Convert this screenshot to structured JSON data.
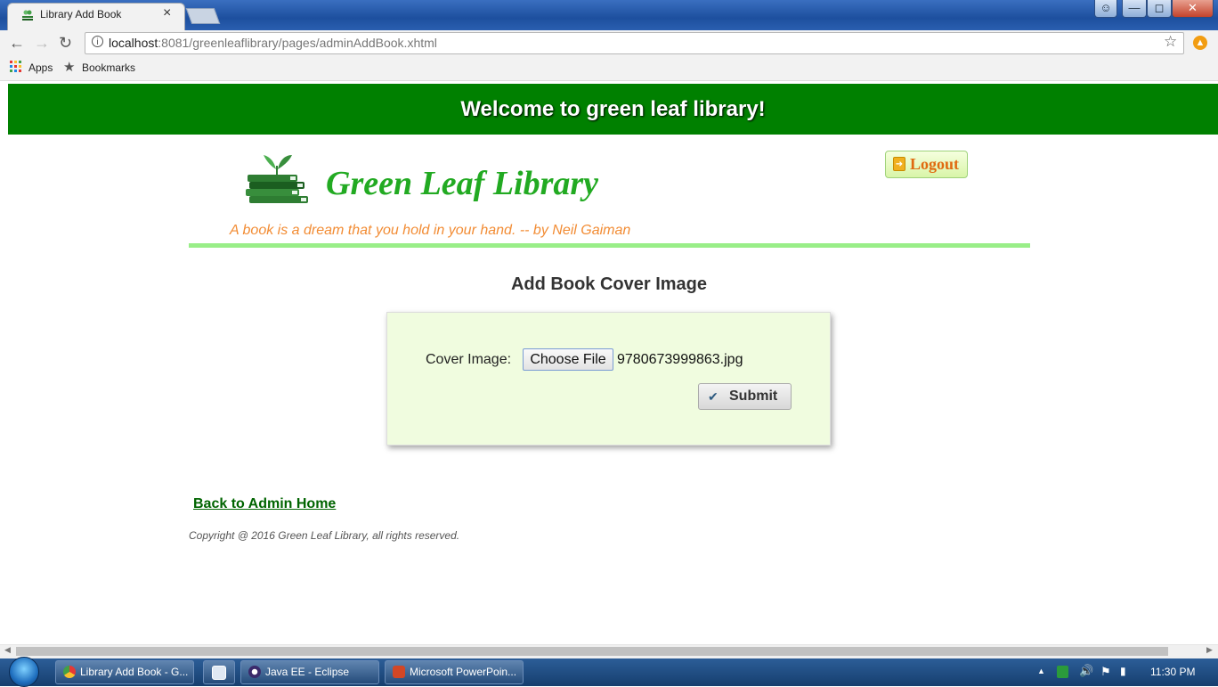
{
  "browser": {
    "tab_title": "Library Add Book",
    "tab_close": "×",
    "url_host": "localhost",
    "url_rest": ":8081/greenleaflibrary/pages/adminAddBook.xhtml",
    "bookmarks": {
      "apps": "Apps",
      "bookmarks": "Bookmarks"
    }
  },
  "page": {
    "banner": "Welcome to green leaf library!",
    "site_name": "Green Leaf Library",
    "logout_label": "Logout",
    "quote": "A book is a dream that you hold in your hand. -- by Neil Gaiman",
    "section_title": "Add Book Cover Image",
    "form": {
      "cover_label": "Cover Image:",
      "choose_file": "Choose File",
      "file_name": "9780673999863.jpg",
      "submit": "Submit"
    },
    "back_link": "Back to Admin Home",
    "copyright": "Copyright @ 2016 Green Leaf Library, all rights reserved."
  },
  "taskbar": {
    "items": [
      {
        "label": "Library Add Book - G..."
      },
      {
        "label": ""
      },
      {
        "label": "Java EE - Eclipse"
      },
      {
        "label": "Microsoft PowerPoin..."
      }
    ],
    "clock": "11:30 PM"
  },
  "colors": {
    "banner": "#008000",
    "brand_green": "#22aa22",
    "quote_orange": "#f28c34",
    "panel_bg": "#f0fcdf",
    "divider": "#99ee88"
  }
}
